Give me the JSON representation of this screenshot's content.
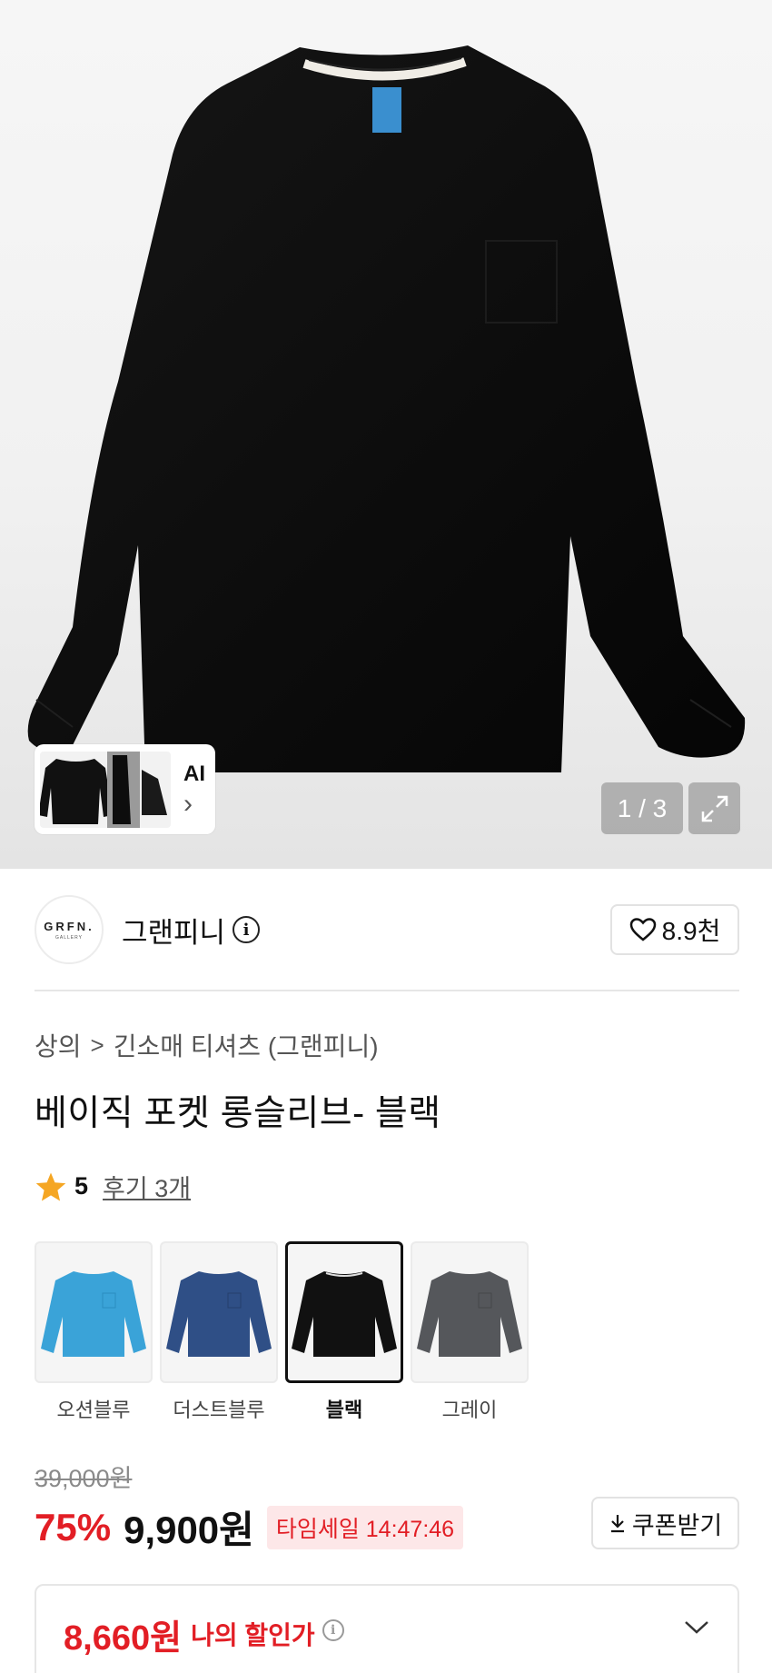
{
  "gallery": {
    "counter": "1 / 3",
    "ai_label": "AI",
    "ai_chevron": "›",
    "expand_icon": "expand-icon"
  },
  "brand": {
    "logo_line1": "GRFN.",
    "logo_line2": "GALLERY",
    "name": "그랜피니",
    "info_icon": "i",
    "likes": "8.9천"
  },
  "breadcrumb": {
    "category": "상의",
    "separator": ">",
    "subcategory": "긴소매 티셔츠 (그랜피니)"
  },
  "product": {
    "title": "베이직 포켓 롱슬리브- 블랙",
    "rating": "5",
    "reviews": "후기 3개"
  },
  "colors": {
    "options": [
      {
        "name": "오션블루",
        "color": "#3aa3d8"
      },
      {
        "name": "더스트블루",
        "color": "#2f4f86"
      },
      {
        "name": "블랙",
        "color": "#111111"
      },
      {
        "name": "그레이",
        "color": "#55575b"
      }
    ],
    "selected": "블랙"
  },
  "pricing": {
    "original": "39,000원",
    "discount": "75%",
    "sale": "9,900원",
    "timesale": "타임세일 14:47:46",
    "coupon_button": "쿠폰받기",
    "my_price": "8,660원",
    "my_price_label": "나의 할인가",
    "accent_red": "#e21e25"
  }
}
